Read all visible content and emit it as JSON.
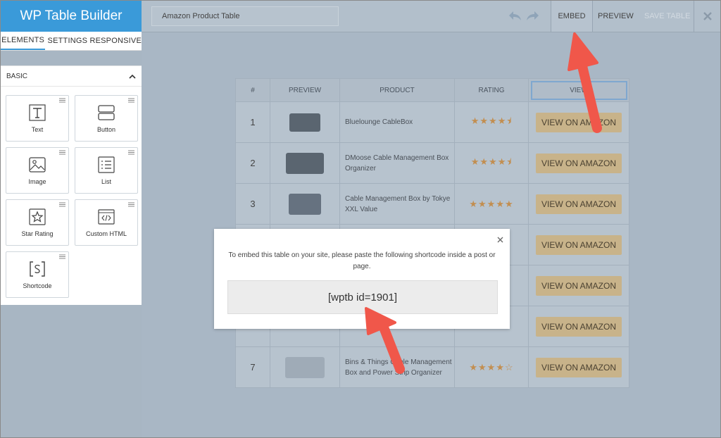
{
  "app": {
    "title": "WP Table Builder"
  },
  "sidebar": {
    "tabs": [
      {
        "label": "ELEMENTS",
        "active": true
      },
      {
        "label": "SETTINGS",
        "active": false
      },
      {
        "label": "RESPONSIVE",
        "active": false
      }
    ],
    "section_label": "BASIC",
    "elements": [
      {
        "label": "Text",
        "icon": "text-icon"
      },
      {
        "label": "Button",
        "icon": "button-icon"
      },
      {
        "label": "Image",
        "icon": "image-icon"
      },
      {
        "label": "List",
        "icon": "list-icon"
      },
      {
        "label": "Star Rating",
        "icon": "star-icon"
      },
      {
        "label": "Custom HTML",
        "icon": "code-icon"
      },
      {
        "label": "Shortcode",
        "icon": "shortcode-icon"
      }
    ]
  },
  "toolbar": {
    "table_title": "Amazon Product Table",
    "embed_label": "EMBED",
    "preview_label": "PREVIEW",
    "save_label": "SAVE TABLE"
  },
  "table": {
    "headers": [
      "#",
      "PREVIEW",
      "PRODUCT",
      "RATING",
      "VIEW"
    ],
    "rows": [
      {
        "num": "1",
        "product": "Bluelounge CableBox",
        "rating": 4.5,
        "button": "VIEW ON AMAZON"
      },
      {
        "num": "2",
        "product": "DMoose Cable Management Box Organizer",
        "rating": 4.5,
        "button": "VIEW ON AMAZON"
      },
      {
        "num": "3",
        "product": "Cable Management Box by Tokye XXL Value",
        "rating": 5,
        "button": "VIEW ON AMAZON"
      },
      {
        "num": "",
        "product": "",
        "rating": null,
        "button": "VIEW ON AMAZON"
      },
      {
        "num": "",
        "product": "",
        "rating": null,
        "button": "VIEW ON AMAZON"
      },
      {
        "num": "",
        "product": "",
        "rating": null,
        "button": "VIEW ON AMAZON"
      },
      {
        "num": "7",
        "product": "Bins & Things Cable Management Box and Power Strip Organizer",
        "rating": 4,
        "button": "VIEW ON AMAZON"
      }
    ]
  },
  "modal": {
    "message": "To embed this table on your site, please paste the following shortcode inside a post or page.",
    "shortcode": "[wptb id=1901]"
  },
  "colors": {
    "accent": "#3a9ad9",
    "amazon_button": "#c8b38a",
    "arrow": "#f0574a"
  }
}
